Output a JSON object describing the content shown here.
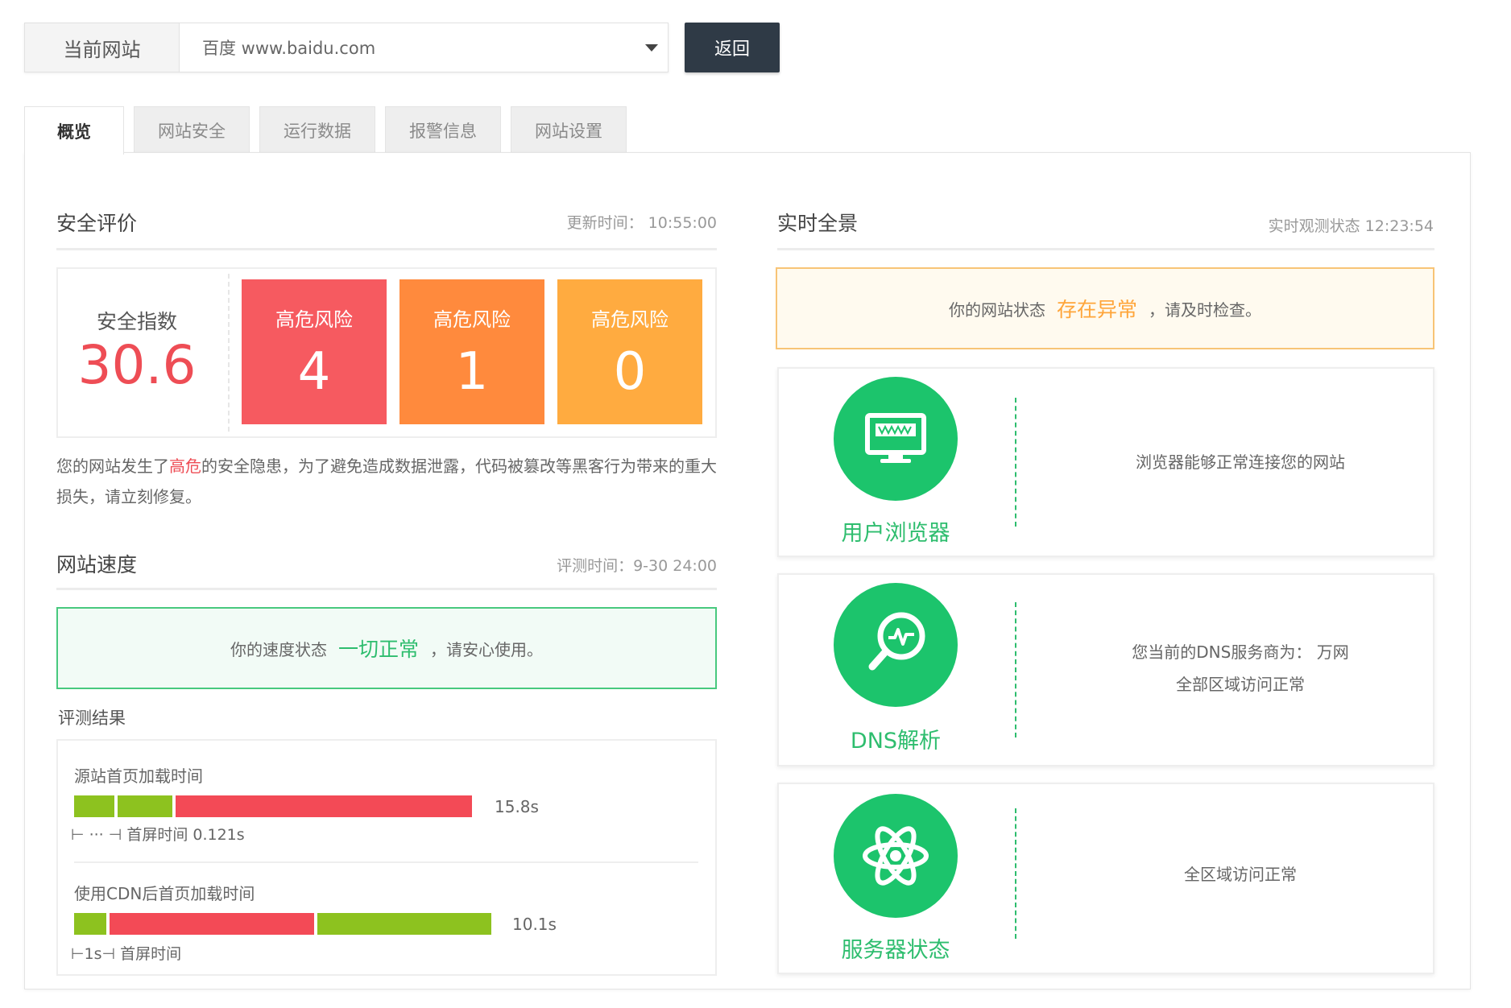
{
  "header": {
    "site_label": "当前网站",
    "site_value": "百度 www.baidu.com",
    "back_label": "返回"
  },
  "tabs": [
    {
      "label": "概览",
      "active": true
    },
    {
      "label": "网站安全",
      "active": false
    },
    {
      "label": "运行数据",
      "active": false
    },
    {
      "label": "报警信息",
      "active": false
    },
    {
      "label": "网站设置",
      "active": false
    }
  ],
  "security": {
    "title": "安全评价",
    "update_time": "更新时间： 10:55:00",
    "score_label": "安全指数",
    "score_value": "30.6",
    "risks": [
      {
        "label": "高危风险",
        "value": "4",
        "color": "#f65a60"
      },
      {
        "label": "高危风险",
        "value": "1",
        "color": "#ff8a3d"
      },
      {
        "label": "高危风险",
        "value": "0",
        "color": "#ffab40"
      }
    ],
    "warning_prefix": "您的网站发生了",
    "warning_highlight": "高危",
    "warning_suffix": "的安全隐患，为了避免造成数据泄露，代码被篡改等黑客行为带来的重大损失，请立刻修复。"
  },
  "speed": {
    "title": "网站速度",
    "eval_time": "评测时间：9-30 24:00",
    "status_prefix": "你的速度状态",
    "status_value": "一切正常",
    "status_suffix": "，请安心使用。",
    "results_title": "评测结果",
    "metrics": [
      {
        "label": "源站首页加载时间",
        "value": "15.8s",
        "note": "⊢ ··· ⊣ 首屏时间 0.121s"
      },
      {
        "label": "使用CDN后首页加载时间",
        "value": "10.1s",
        "note": "⊢1s⊣ 首屏时间"
      }
    ]
  },
  "realtime": {
    "title": "实时全景",
    "observe_time": "实时观测状态 12:23:54",
    "alert_prefix": "你的网站状态",
    "alert_value": "存在异常",
    "alert_suffix": "，请及时检查。",
    "cards": [
      {
        "label": "用户浏览器",
        "icon": "browser-monitor-icon",
        "desc_line1": "浏览器能够正常连接您的网站",
        "desc_line2": ""
      },
      {
        "label": "DNS解析",
        "icon": "dns-search-icon",
        "desc_line1": "您当前的DNS服务商为： 万网",
        "desc_line2": "全部区域访问正常"
      },
      {
        "label": "服务器状态",
        "icon": "server-atom-icon",
        "desc_line1": "全区域访问正常",
        "desc_line2": ""
      }
    ]
  },
  "colors": {
    "accent_green": "#1cc46c",
    "danger_red": "#ee4d55",
    "warning_orange": "#ffa53a",
    "dark_button": "#2f3a46"
  }
}
